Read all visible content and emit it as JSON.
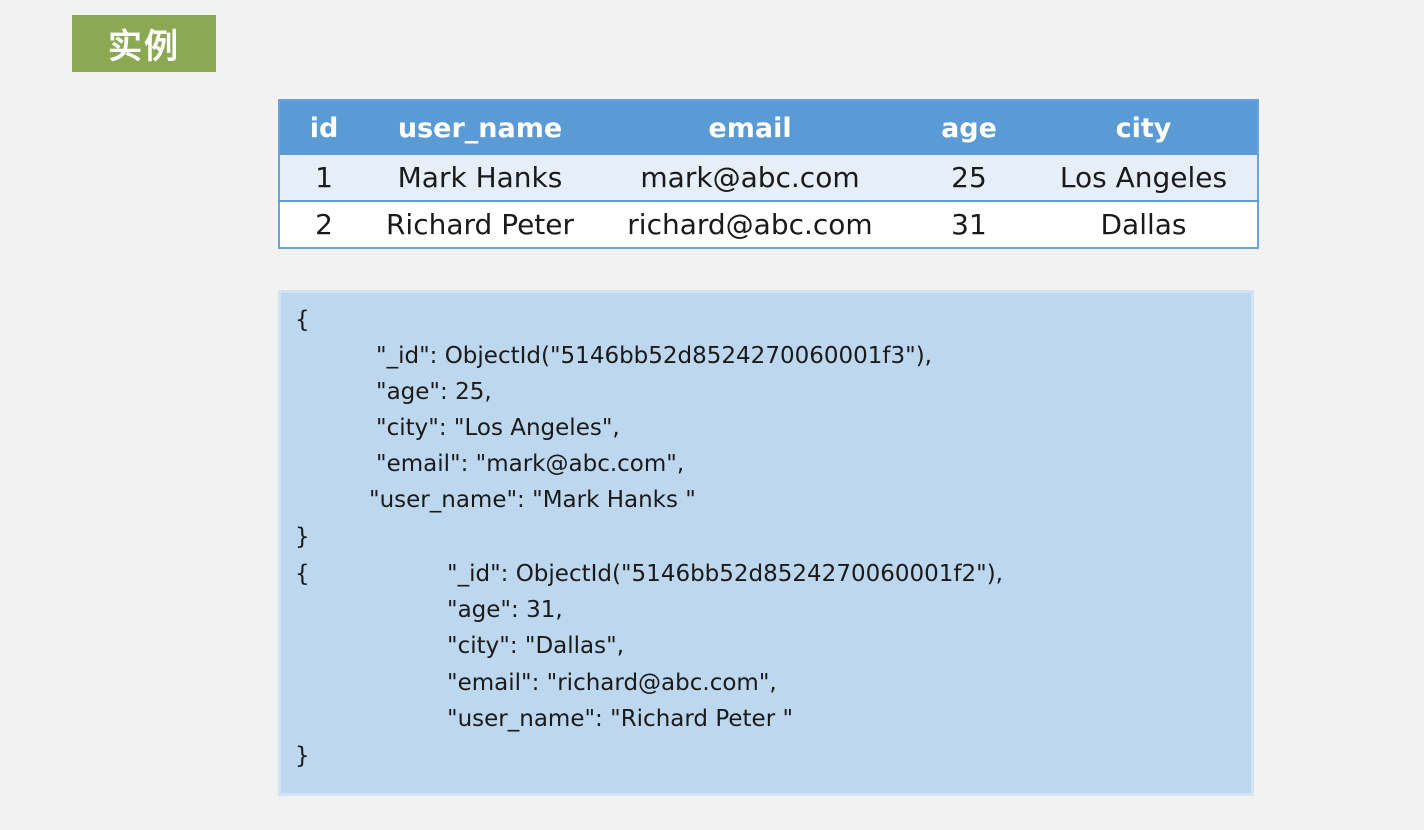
{
  "header": {
    "title": "实例"
  },
  "table": {
    "columns": [
      "id",
      "user_name",
      "email",
      "age",
      "city"
    ],
    "rows": [
      [
        "1",
        "Mark Hanks",
        "mark@abc.com",
        "25",
        "Los Angeles"
      ],
      [
        "2",
        "Richard Peter",
        "richard@abc.com",
        "31",
        "Dallas"
      ]
    ]
  },
  "json_block": {
    "doc1": {
      "open": "{",
      "id_line": "\"_id\": ObjectId(\"5146bb52d8524270060001f3\"),",
      "age_line": "\"age\": 25,",
      "city_line": "\"city\": \"Los Angeles\",",
      "email_line": "\"email\": \"mark@abc.com\",",
      "user_line": "\"user_name\": \"Mark Hanks \"",
      "close": "}"
    },
    "doc2": {
      "open": "{",
      "id_line": "\"_id\": ObjectId(\"5146bb52d8524270060001f2\"),",
      "age_line": "\"age\": 31,",
      "city_line": "\"city\": \"Dallas\",",
      "email_line": "\"email\": \"richard@abc.com\",",
      "user_line": "\"user_name\": \"Richard Peter \"",
      "close": "}"
    }
  },
  "colors": {
    "title_badge": "#8ba952",
    "table_header": "#5b9bd5",
    "table_row_alt": "#e6eef8",
    "json_panel": "#bdd7ee",
    "background": "#f2f2f2"
  }
}
